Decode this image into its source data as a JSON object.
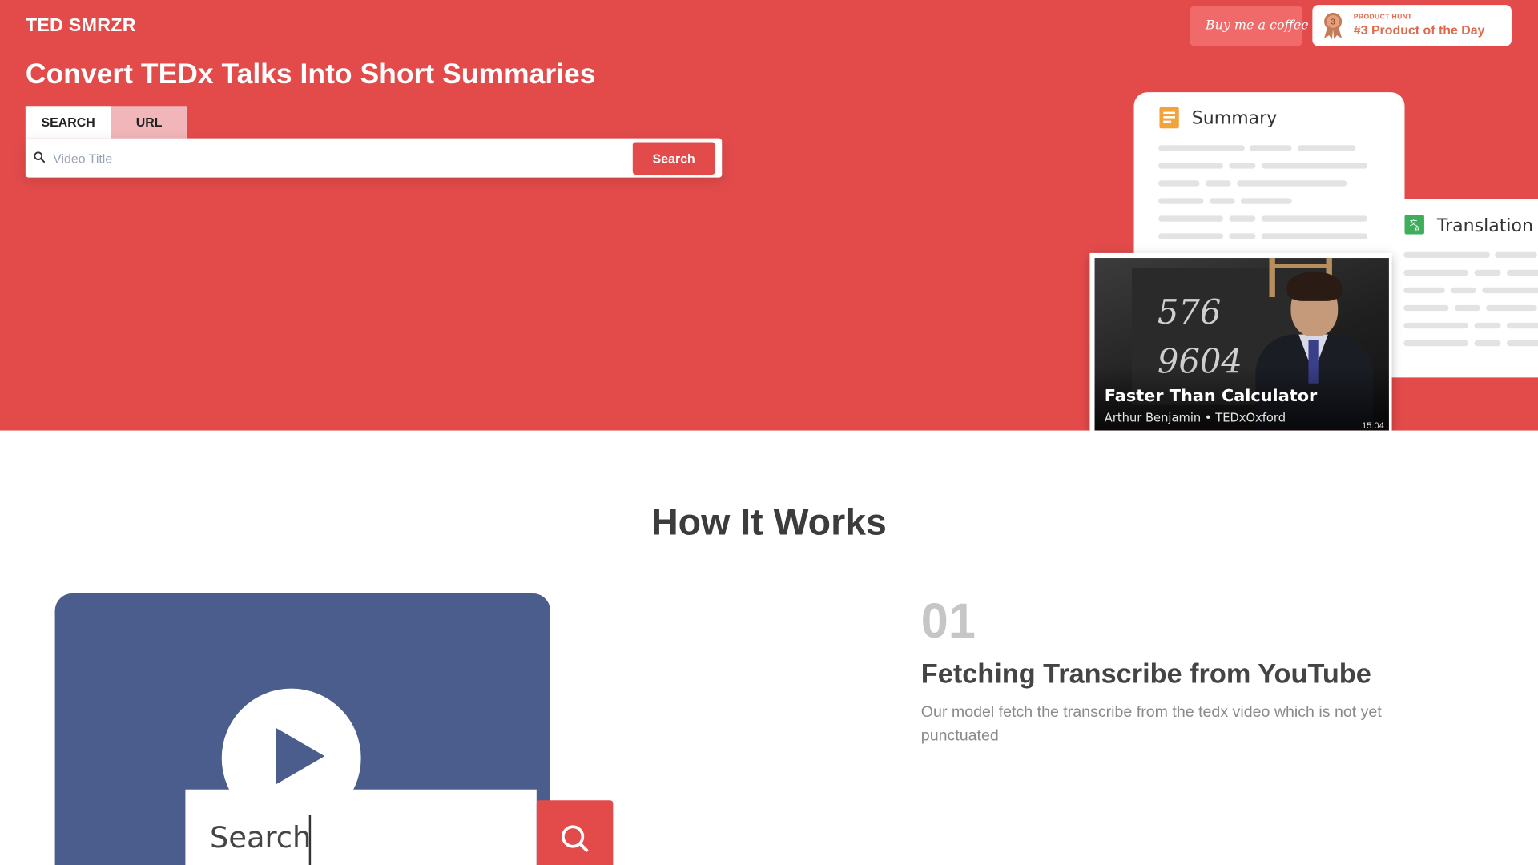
{
  "app": {
    "brand": "TED SMRZR",
    "headline": "Convert TEDx Talks Into Short Summaries"
  },
  "header": {
    "coffee_label": "Buy me a coffee",
    "product_hunt": {
      "kicker": "PRODUCT HUNT",
      "title": "#3 Product of the Day",
      "rank": "3"
    }
  },
  "search": {
    "tabs": [
      {
        "label": "SEARCH"
      },
      {
        "label": "URL"
      }
    ],
    "placeholder": "Video Title",
    "button_label": "Search"
  },
  "preview": {
    "summary_title": "Summary",
    "translation_title": "Translation",
    "video": {
      "title": "Faster Than Calculator",
      "subtitle": "Arthur Benjamin • TEDxOxford",
      "duration": "15:04",
      "chalk_1": "576",
      "chalk_2": "9604"
    }
  },
  "how_it_works": {
    "title": "How It Works",
    "demo_search_text": "Search",
    "step": {
      "number": "01",
      "title": "Fetching Transcribe from YouTube",
      "description": "Our model fetch the transcribe from the tedx video which is not yet punctuated"
    }
  },
  "colors": {
    "accent": "#e34b4b",
    "tab_inactive": "#f0b6b9",
    "demo_card": "#4b5d8c",
    "step_number": "#c6c6c6"
  },
  "icons": [
    "search-icon",
    "coffee-cup-icon",
    "medal-icon",
    "document-icon",
    "translate-icon",
    "play-icon"
  ]
}
